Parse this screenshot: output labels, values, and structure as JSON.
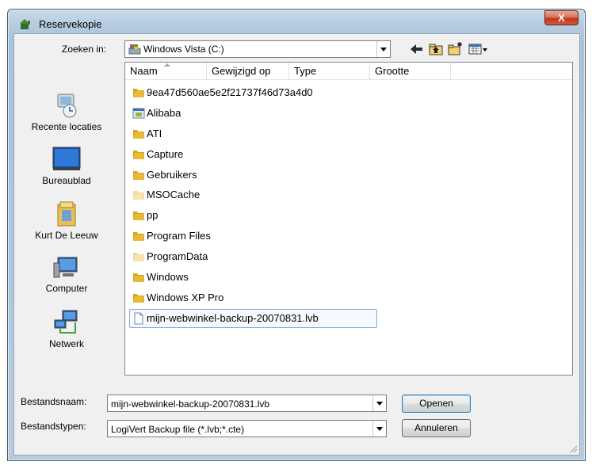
{
  "window": {
    "title": "Reservekopie",
    "close_glyph": "X"
  },
  "lookin": {
    "label": "Zoeken in:",
    "value": "Windows Vista (C:)"
  },
  "toolbar": {
    "back_icon": "back-arrow-icon",
    "up_icon": "folder-up-icon",
    "new_folder_icon": "new-folder-icon",
    "view_menu_icon": "view-menu-icon"
  },
  "places": [
    {
      "label": "Recente locaties",
      "icon": "recent-locations-icon"
    },
    {
      "label": "Bureaublad",
      "icon": "desktop-icon"
    },
    {
      "label": "Kurt De Leeuw",
      "icon": "user-folder-icon"
    },
    {
      "label": "Computer",
      "icon": "computer-icon"
    },
    {
      "label": "Netwerk",
      "icon": "network-icon"
    }
  ],
  "columns": [
    "Naam",
    "Gewijzigd op",
    "Type",
    "Grootte"
  ],
  "files": [
    {
      "name": "9ea47d560ae5e2f21737f46d73a4d0",
      "icon": "folder"
    },
    {
      "name": "Alibaba",
      "icon": "app"
    },
    {
      "name": "ATI",
      "icon": "folder"
    },
    {
      "name": "Capture",
      "icon": "folder"
    },
    {
      "name": "Gebruikers",
      "icon": "folder"
    },
    {
      "name": "MSOCache",
      "icon": "folder-faded"
    },
    {
      "name": "pp",
      "icon": "folder"
    },
    {
      "name": "Program Files",
      "icon": "folder"
    },
    {
      "name": "ProgramData",
      "icon": "folder-faded"
    },
    {
      "name": "Windows",
      "icon": "folder"
    },
    {
      "name": "Windows XP Pro",
      "icon": "folder"
    },
    {
      "name": "mijn-webwinkel-backup-20070831.lvb",
      "icon": "file",
      "selected": true
    }
  ],
  "filename": {
    "label": "Bestandsnaam:",
    "value": "mijn-webwinkel-backup-20070831.lvb"
  },
  "filetype": {
    "label": "Bestandstypen:",
    "value": "LogiVert Backup file (*.lvb;*.cte)"
  },
  "buttons": {
    "open": "Openen",
    "cancel": "Annuleren"
  },
  "colors": {
    "folder": "#e8b93a",
    "selection_border": "#84acdd",
    "title_bar": "#b7cde0"
  }
}
